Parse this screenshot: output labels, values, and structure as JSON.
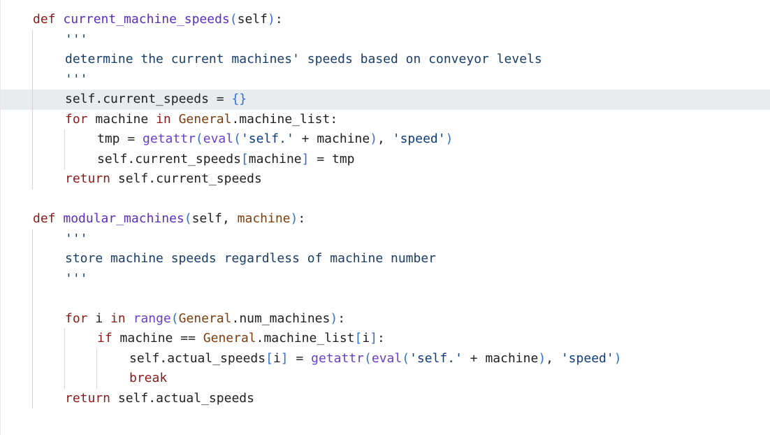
{
  "theme": {
    "keyword": "#8b1a1a",
    "function": "#5a2ec1",
    "builtin": "#6a3fc8",
    "string": "#0f3b7a",
    "bracket": "#2f6fd6",
    "class_ref": "#7a3d0f",
    "current_line_bg": "#e9ecef"
  },
  "lines": [
    {
      "indent": 0,
      "tokens": [
        {
          "t": "kw",
          "v": "def"
        },
        {
          "t": "p",
          "v": " "
        },
        {
          "t": "fn",
          "v": "current_machine_speeds"
        },
        {
          "t": "br",
          "v": "("
        },
        {
          "t": "self",
          "v": "self"
        },
        {
          "t": "br",
          "v": ")"
        },
        {
          "t": "p",
          "v": ":"
        }
      ]
    },
    {
      "indent": 1,
      "tokens": [
        {
          "t": "doc",
          "v": "'''"
        }
      ]
    },
    {
      "indent": 1,
      "tokens": [
        {
          "t": "doc",
          "v": "determine the current machines' speeds based on conveyor levels"
        }
      ]
    },
    {
      "indent": 1,
      "tokens": [
        {
          "t": "doc",
          "v": "'''"
        }
      ]
    },
    {
      "indent": 1,
      "current": true,
      "tokens": [
        {
          "t": "self",
          "v": "self"
        },
        {
          "t": "p",
          "v": "."
        },
        {
          "t": "id",
          "v": "current_speeds"
        },
        {
          "t": "p",
          "v": " "
        },
        {
          "t": "op",
          "v": "="
        },
        {
          "t": "p",
          "v": " "
        },
        {
          "t": "br",
          "v": "{}"
        }
      ]
    },
    {
      "indent": 1,
      "tokens": [
        {
          "t": "kw",
          "v": "for"
        },
        {
          "t": "p",
          "v": " "
        },
        {
          "t": "id",
          "v": "machine"
        },
        {
          "t": "p",
          "v": " "
        },
        {
          "t": "kw",
          "v": "in"
        },
        {
          "t": "p",
          "v": " "
        },
        {
          "t": "cls",
          "v": "General"
        },
        {
          "t": "p",
          "v": "."
        },
        {
          "t": "id",
          "v": "machine_list"
        },
        {
          "t": "p",
          "v": ":"
        }
      ]
    },
    {
      "indent": 2,
      "tokens": [
        {
          "t": "id",
          "v": "tmp"
        },
        {
          "t": "p",
          "v": " "
        },
        {
          "t": "op",
          "v": "="
        },
        {
          "t": "p",
          "v": " "
        },
        {
          "t": "bi",
          "v": "getattr"
        },
        {
          "t": "br",
          "v": "("
        },
        {
          "t": "bi",
          "v": "eval"
        },
        {
          "t": "br",
          "v": "("
        },
        {
          "t": "str",
          "v": "'self.'"
        },
        {
          "t": "p",
          "v": " "
        },
        {
          "t": "op",
          "v": "+"
        },
        {
          "t": "p",
          "v": " "
        },
        {
          "t": "id",
          "v": "machine"
        },
        {
          "t": "br",
          "v": ")"
        },
        {
          "t": "p",
          "v": ", "
        },
        {
          "t": "str",
          "v": "'speed'"
        },
        {
          "t": "br",
          "v": ")"
        }
      ]
    },
    {
      "indent": 2,
      "tokens": [
        {
          "t": "self",
          "v": "self"
        },
        {
          "t": "p",
          "v": "."
        },
        {
          "t": "id",
          "v": "current_speeds"
        },
        {
          "t": "br",
          "v": "["
        },
        {
          "t": "id",
          "v": "machine"
        },
        {
          "t": "br",
          "v": "]"
        },
        {
          "t": "p",
          "v": " "
        },
        {
          "t": "op",
          "v": "="
        },
        {
          "t": "p",
          "v": " "
        },
        {
          "t": "id",
          "v": "tmp"
        }
      ]
    },
    {
      "indent": 1,
      "tokens": [
        {
          "t": "kw",
          "v": "return"
        },
        {
          "t": "p",
          "v": " "
        },
        {
          "t": "self",
          "v": "self"
        },
        {
          "t": "p",
          "v": "."
        },
        {
          "t": "id",
          "v": "current_speeds"
        }
      ]
    },
    {
      "indent": 0,
      "tokens": []
    },
    {
      "indent": 0,
      "tokens": [
        {
          "t": "kw",
          "v": "def"
        },
        {
          "t": "p",
          "v": " "
        },
        {
          "t": "fn",
          "v": "modular_machines"
        },
        {
          "t": "br",
          "v": "("
        },
        {
          "t": "self",
          "v": "self"
        },
        {
          "t": "p",
          "v": ", "
        },
        {
          "t": "param",
          "v": "machine"
        },
        {
          "t": "br",
          "v": ")"
        },
        {
          "t": "p",
          "v": ":"
        }
      ]
    },
    {
      "indent": 1,
      "tokens": [
        {
          "t": "doc",
          "v": "'''"
        }
      ]
    },
    {
      "indent": 1,
      "tokens": [
        {
          "t": "doc",
          "v": "store machine speeds regardless of machine number"
        }
      ]
    },
    {
      "indent": 1,
      "tokens": [
        {
          "t": "doc",
          "v": "'''"
        }
      ]
    },
    {
      "indent": 0,
      "tokens": []
    },
    {
      "indent": 1,
      "tokens": [
        {
          "t": "kw",
          "v": "for"
        },
        {
          "t": "p",
          "v": " "
        },
        {
          "t": "id",
          "v": "i"
        },
        {
          "t": "p",
          "v": " "
        },
        {
          "t": "kw",
          "v": "in"
        },
        {
          "t": "p",
          "v": " "
        },
        {
          "t": "bi",
          "v": "range"
        },
        {
          "t": "br",
          "v": "("
        },
        {
          "t": "cls",
          "v": "General"
        },
        {
          "t": "p",
          "v": "."
        },
        {
          "t": "id",
          "v": "num_machines"
        },
        {
          "t": "br",
          "v": ")"
        },
        {
          "t": "p",
          "v": ":"
        }
      ]
    },
    {
      "indent": 2,
      "tokens": [
        {
          "t": "kw",
          "v": "if"
        },
        {
          "t": "p",
          "v": " "
        },
        {
          "t": "id",
          "v": "machine"
        },
        {
          "t": "p",
          "v": " "
        },
        {
          "t": "op",
          "v": "=="
        },
        {
          "t": "p",
          "v": " "
        },
        {
          "t": "cls",
          "v": "General"
        },
        {
          "t": "p",
          "v": "."
        },
        {
          "t": "id",
          "v": "machine_list"
        },
        {
          "t": "br",
          "v": "["
        },
        {
          "t": "id",
          "v": "i"
        },
        {
          "t": "br",
          "v": "]"
        },
        {
          "t": "p",
          "v": ":"
        }
      ]
    },
    {
      "indent": 3,
      "tokens": [
        {
          "t": "self",
          "v": "self"
        },
        {
          "t": "p",
          "v": "."
        },
        {
          "t": "id",
          "v": "actual_speeds"
        },
        {
          "t": "br",
          "v": "["
        },
        {
          "t": "id",
          "v": "i"
        },
        {
          "t": "br",
          "v": "]"
        },
        {
          "t": "p",
          "v": " "
        },
        {
          "t": "op",
          "v": "="
        },
        {
          "t": "p",
          "v": " "
        },
        {
          "t": "bi",
          "v": "getattr"
        },
        {
          "t": "br",
          "v": "("
        },
        {
          "t": "bi",
          "v": "eval"
        },
        {
          "t": "br",
          "v": "("
        },
        {
          "t": "str",
          "v": "'self.'"
        },
        {
          "t": "p",
          "v": " "
        },
        {
          "t": "op",
          "v": "+"
        },
        {
          "t": "p",
          "v": " "
        },
        {
          "t": "id",
          "v": "machine"
        },
        {
          "t": "br",
          "v": ")"
        },
        {
          "t": "p",
          "v": ", "
        },
        {
          "t": "str",
          "v": "'speed'"
        },
        {
          "t": "br",
          "v": ")"
        }
      ]
    },
    {
      "indent": 3,
      "tokens": [
        {
          "t": "kw",
          "v": "break"
        }
      ]
    },
    {
      "indent": 1,
      "tokens": [
        {
          "t": "kw",
          "v": "return"
        },
        {
          "t": "p",
          "v": " "
        },
        {
          "t": "self",
          "v": "self"
        },
        {
          "t": "p",
          "v": "."
        },
        {
          "t": "id",
          "v": "actual_speeds"
        }
      ]
    }
  ]
}
